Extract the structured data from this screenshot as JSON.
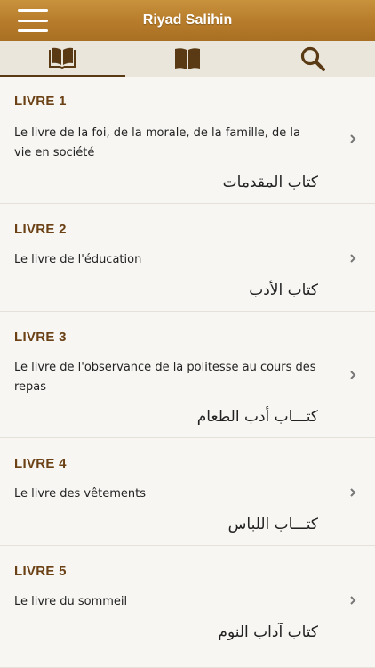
{
  "header": {
    "title": "Riyad Salihin"
  },
  "tabs": [
    {
      "icon": "open-book-icon",
      "active": true
    },
    {
      "icon": "closed-book-icon",
      "active": false
    },
    {
      "icon": "search-icon",
      "active": false
    }
  ],
  "colors": {
    "accent": "#6b4115",
    "navbar": "#b87d2c"
  },
  "books": [
    {
      "heading": "LIVRE 1",
      "description": "Le livre de la foi, de la morale, de la famille, de la vie en société",
      "arabic": "كتاب المقدمات"
    },
    {
      "heading": "LIVRE 2",
      "description": "Le livre de l'éducation",
      "arabic": "كتاب الأدب"
    },
    {
      "heading": "LIVRE 3",
      "description": "Le livre de l'observance de la politesse au cours des repas",
      "arabic": "كتـــاب أدب الطعام"
    },
    {
      "heading": "LIVRE 4",
      "description": "Le livre des vêtements",
      "arabic": "كتـــاب اللباس"
    },
    {
      "heading": "LIVRE 5",
      "description": "Le livre du sommeil",
      "arabic": "كتاب آداب النوم"
    }
  ]
}
